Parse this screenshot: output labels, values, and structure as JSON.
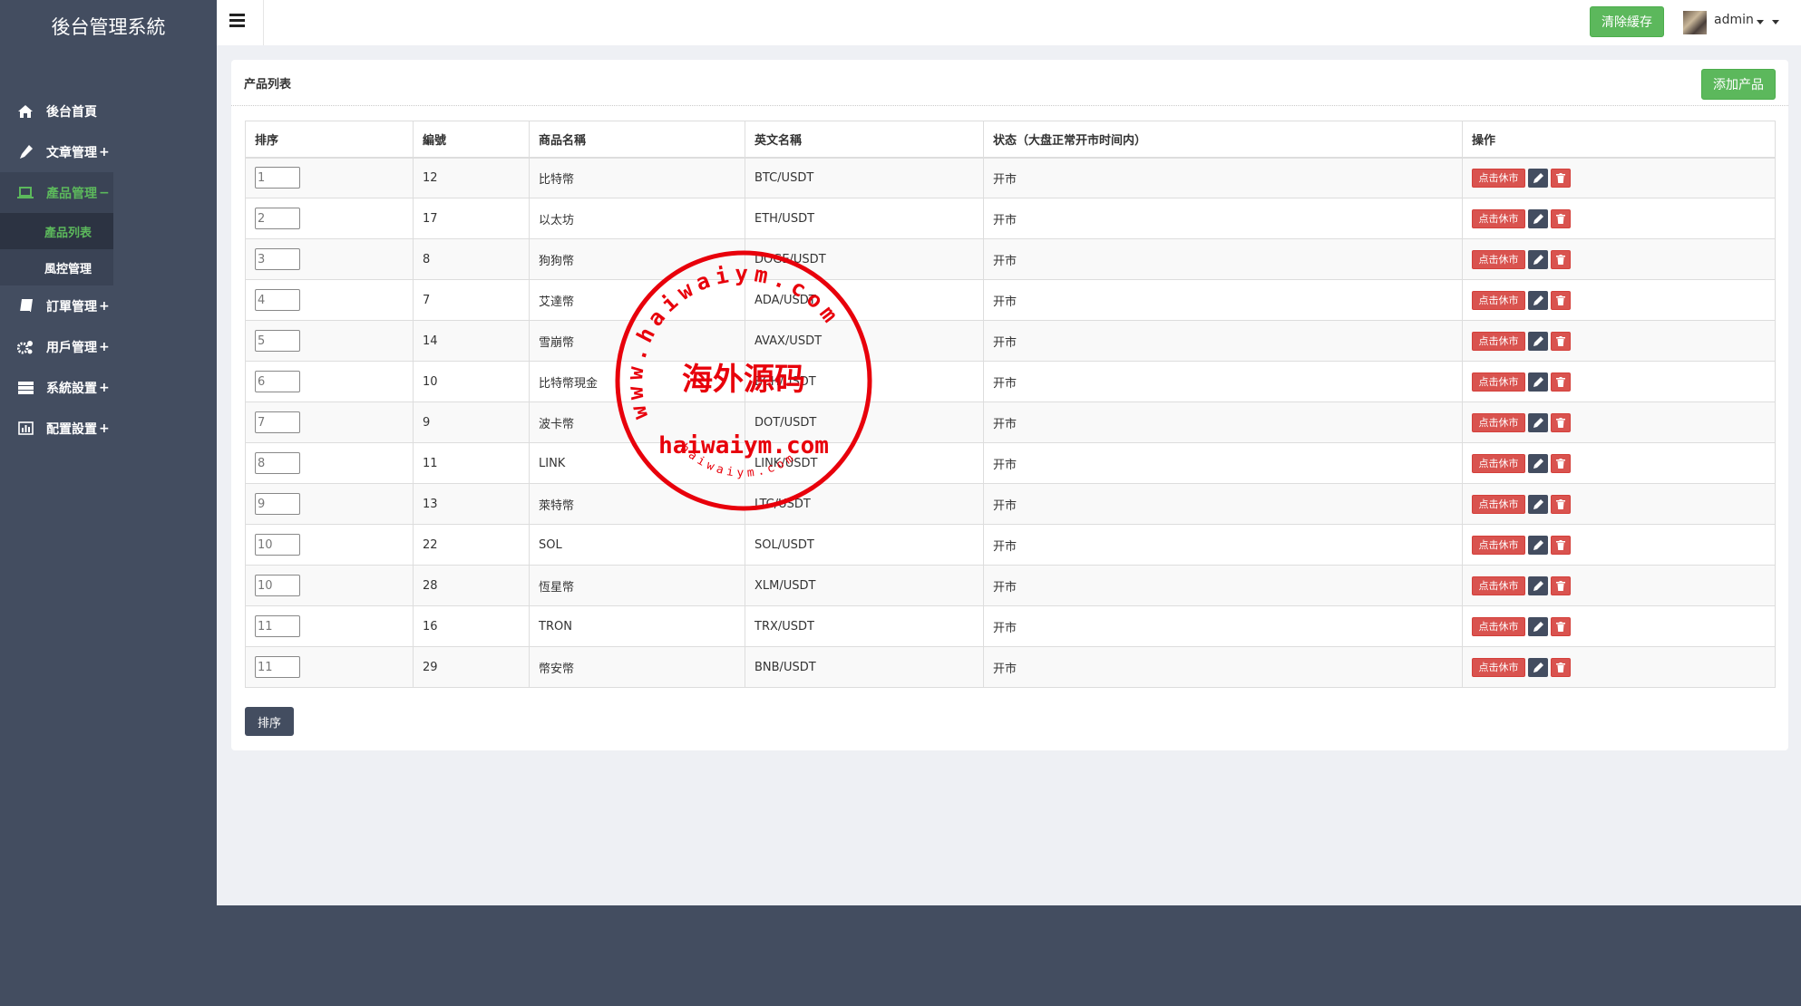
{
  "app": {
    "title": "後台管理系統"
  },
  "sidebar": {
    "items": [
      {
        "label": "後台首頁",
        "icon": "home-icon"
      },
      {
        "label": "文章管理",
        "suffix": "+",
        "icon": "pencil-icon"
      },
      {
        "label": "產品管理",
        "suffix": "−",
        "icon": "laptop-icon",
        "active": true,
        "children": [
          {
            "label": "產品列表",
            "current": true
          },
          {
            "label": "風控管理"
          }
        ]
      },
      {
        "label": "訂單管理",
        "suffix": "+",
        "icon": "book-icon"
      },
      {
        "label": "用戶管理",
        "suffix": "+",
        "icon": "gears-icon"
      },
      {
        "label": "系統設置",
        "suffix": "+",
        "icon": "server-icon"
      },
      {
        "label": "配置設置",
        "suffix": "+",
        "icon": "bar-chart-icon"
      }
    ]
  },
  "topbar": {
    "clear_cache": "清除緩存",
    "user": "admin"
  },
  "panel": {
    "title": "产品列表",
    "add_button": "添加产品",
    "sort_button": "排序"
  },
  "table": {
    "headers": [
      "排序",
      "編號",
      "商品名稱",
      "英文名稱",
      "状态（大盘正常开市时间内）",
      "操作"
    ],
    "action_labels": {
      "close_market": "点击休市"
    },
    "rows": [
      {
        "sort": "1",
        "id": "12",
        "name": "比特幣",
        "en": "BTC/USDT",
        "status": "开市"
      },
      {
        "sort": "2",
        "id": "17",
        "name": "以太坊",
        "en": "ETH/USDT",
        "status": "开市"
      },
      {
        "sort": "3",
        "id": "8",
        "name": "狗狗幣",
        "en": "DOGE/USDT",
        "status": "开市"
      },
      {
        "sort": "4",
        "id": "7",
        "name": "艾達幣",
        "en": "ADA/USDT",
        "status": "开市"
      },
      {
        "sort": "5",
        "id": "14",
        "name": "雪崩幣",
        "en": "AVAX/USDT",
        "status": "开市"
      },
      {
        "sort": "6",
        "id": "10",
        "name": "比特幣現金",
        "en": "BCH/USDT",
        "status": "开市"
      },
      {
        "sort": "7",
        "id": "9",
        "name": "波卡幣",
        "en": "DOT/USDT",
        "status": "开市"
      },
      {
        "sort": "8",
        "id": "11",
        "name": "LINK",
        "en": "LINK/USDT",
        "status": "开市"
      },
      {
        "sort": "9",
        "id": "13",
        "name": "萊特幣",
        "en": "LTC/USDT",
        "status": "开市"
      },
      {
        "sort": "10",
        "id": "22",
        "name": "SOL",
        "en": "SOL/USDT",
        "status": "开市"
      },
      {
        "sort": "10",
        "id": "28",
        "name": "恆星幣",
        "en": "XLM/USDT",
        "status": "开市"
      },
      {
        "sort": "11",
        "id": "16",
        "name": "TRON",
        "en": "TRX/USDT",
        "status": "开市"
      },
      {
        "sort": "11",
        "id": "29",
        "name": "幣安幣",
        "en": "BNB/USDT",
        "status": "开市"
      }
    ]
  },
  "watermark": {
    "ring_text": "www.haiwaiym.com",
    "center_text": "海外源码",
    "domain_text": "haiwaiym.com",
    "bottom_text": "haiwaiym.com"
  },
  "colors": {
    "sidebar": "#434d60",
    "accent_green": "#5cb85c",
    "danger": "#d9534f",
    "stamp": "#e8000b"
  }
}
